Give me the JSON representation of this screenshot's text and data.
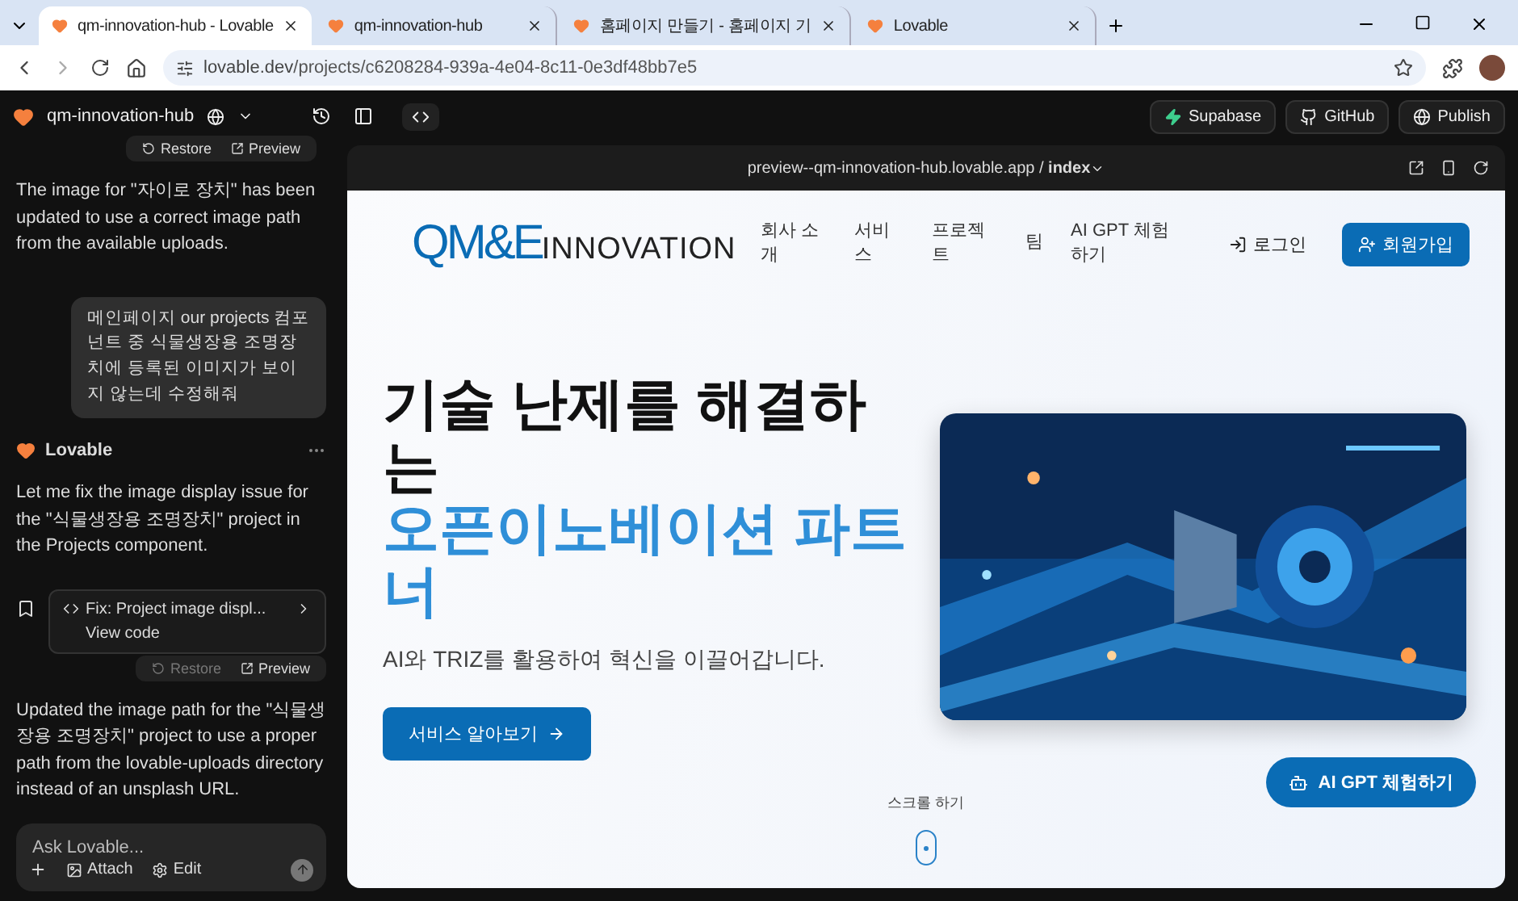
{
  "browser": {
    "tabs": [
      {
        "title": "qm-innovation-hub - Lovable",
        "selected": true
      },
      {
        "title": "qm-innovation-hub",
        "selected": false
      },
      {
        "title": "홈페이지 만들기 - 홈페이지 기",
        "selected": false
      },
      {
        "title": "Lovable",
        "selected": false
      }
    ],
    "url": {
      "host": "lovable.dev",
      "path": "/projects/c6208284-939a-4e04-8c11-0e3df48bb7e5"
    }
  },
  "app_bar": {
    "project": "qm-innovation-hub",
    "buttons": [
      "Supabase",
      "GitHub",
      "Publish"
    ]
  },
  "chat": {
    "top_actions": [
      {
        "label": "Restore",
        "disabled": false
      },
      {
        "label": "Preview",
        "disabled": false
      }
    ],
    "messages": [
      {
        "kind": "assistant",
        "text": "The image for \"자이로 장치\" has been updated to use a correct image path from the available uploads."
      },
      {
        "kind": "user",
        "text": "메인페이지 our projects 컴포넌트 중 식물생장용 조명장치에 등록된 이미지가 보이지 않는데 수정해줘"
      },
      {
        "kind": "author",
        "text": "Lovable"
      },
      {
        "kind": "assistant",
        "text": "Let me fix the image display issue for the \"식물생장용 조명장치\" project in the Projects component."
      },
      {
        "kind": "commit",
        "text": "Fix: Project image displ...",
        "link": "View code",
        "actions": [
          {
            "label": "Restore",
            "disabled": true
          },
          {
            "label": "Preview",
            "disabled": false
          }
        ]
      },
      {
        "kind": "assistant",
        "text": "Updated the image path for the \"식물생장용 조명장치\" project to use a proper path from the lovable-uploads directory instead of an unsplash URL."
      }
    ],
    "input": {
      "placeholder": "Ask Lovable...",
      "tools": [
        "Attach",
        "Edit"
      ]
    }
  },
  "preview": {
    "url": "preview--qm-innovation-hub.lovable.app / **index**",
    "site": {
      "logo": {
        "mark": "QM&E",
        "word": "INNOVATION"
      },
      "nav": [
        "회사 소개",
        "서비스",
        "프로젝트",
        "팀",
        "AI GPT 체험하기"
      ],
      "login": "로그인",
      "signup": "회원가입",
      "headline": "기술 난제를 해결하는",
      "headline_accent": "오픈이노베이션 파트너",
      "subtitle": "AI와 TRIZ를 활용하여 혁신을 이끌어갑니다.",
      "cta": "서비스 알아보기",
      "scroll_hint": "스크롤 하기",
      "chat_button": "AI GPT 체험하기"
    }
  }
}
